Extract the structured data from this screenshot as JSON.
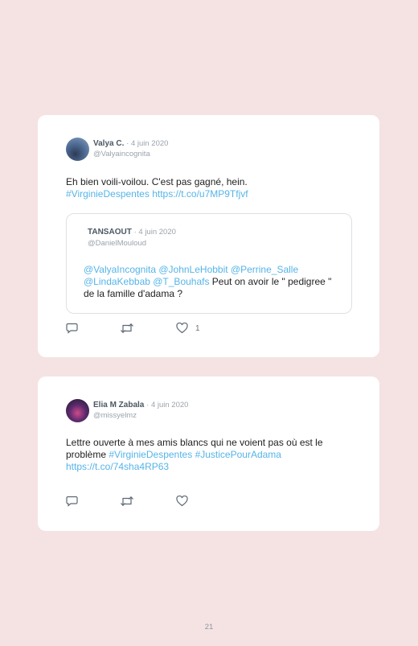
{
  "tweets": [
    {
      "name": "Valya C.",
      "date": "· 4 juin 2020",
      "handle": "@Valyaincognita",
      "text_plain": "Eh bien voili-voilou. C'est pas gagné, hein.",
      "hashtag": "#VirginieDespentes",
      "link": "https://t.co/u7MP9Tfjvf",
      "quote": {
        "name": "TANSAOUT",
        "date": "· 4 juin 2020",
        "handle": "@DanielMouloud",
        "mentions": "@ValyaIncognita @JohnLeHobbit @Perrine_Salle @LindaKebbab @T_Bouhafs",
        "text": " Peut on avoir le \" pedigree \" de la famille d'adama ?"
      },
      "like_count": "1"
    },
    {
      "name": "Elia M Zabala",
      "date": "· 4 juin 2020",
      "handle": "@missyelmz",
      "text_plain": "Lettre ouverte à mes amis blancs qui ne voient pas où est le problème",
      "hashtag1": "#VirginieDespentes",
      "hashtag2": "#JusticePourAdama",
      "link": "https://t.co/74sha4RP63",
      "like_count": ""
    }
  ],
  "icons": [
    "reply-icon",
    "retweet-icon",
    "like-icon"
  ],
  "colors": {
    "background": "#f5e3e3",
    "link": "#55b4e8"
  },
  "page_number": "21"
}
